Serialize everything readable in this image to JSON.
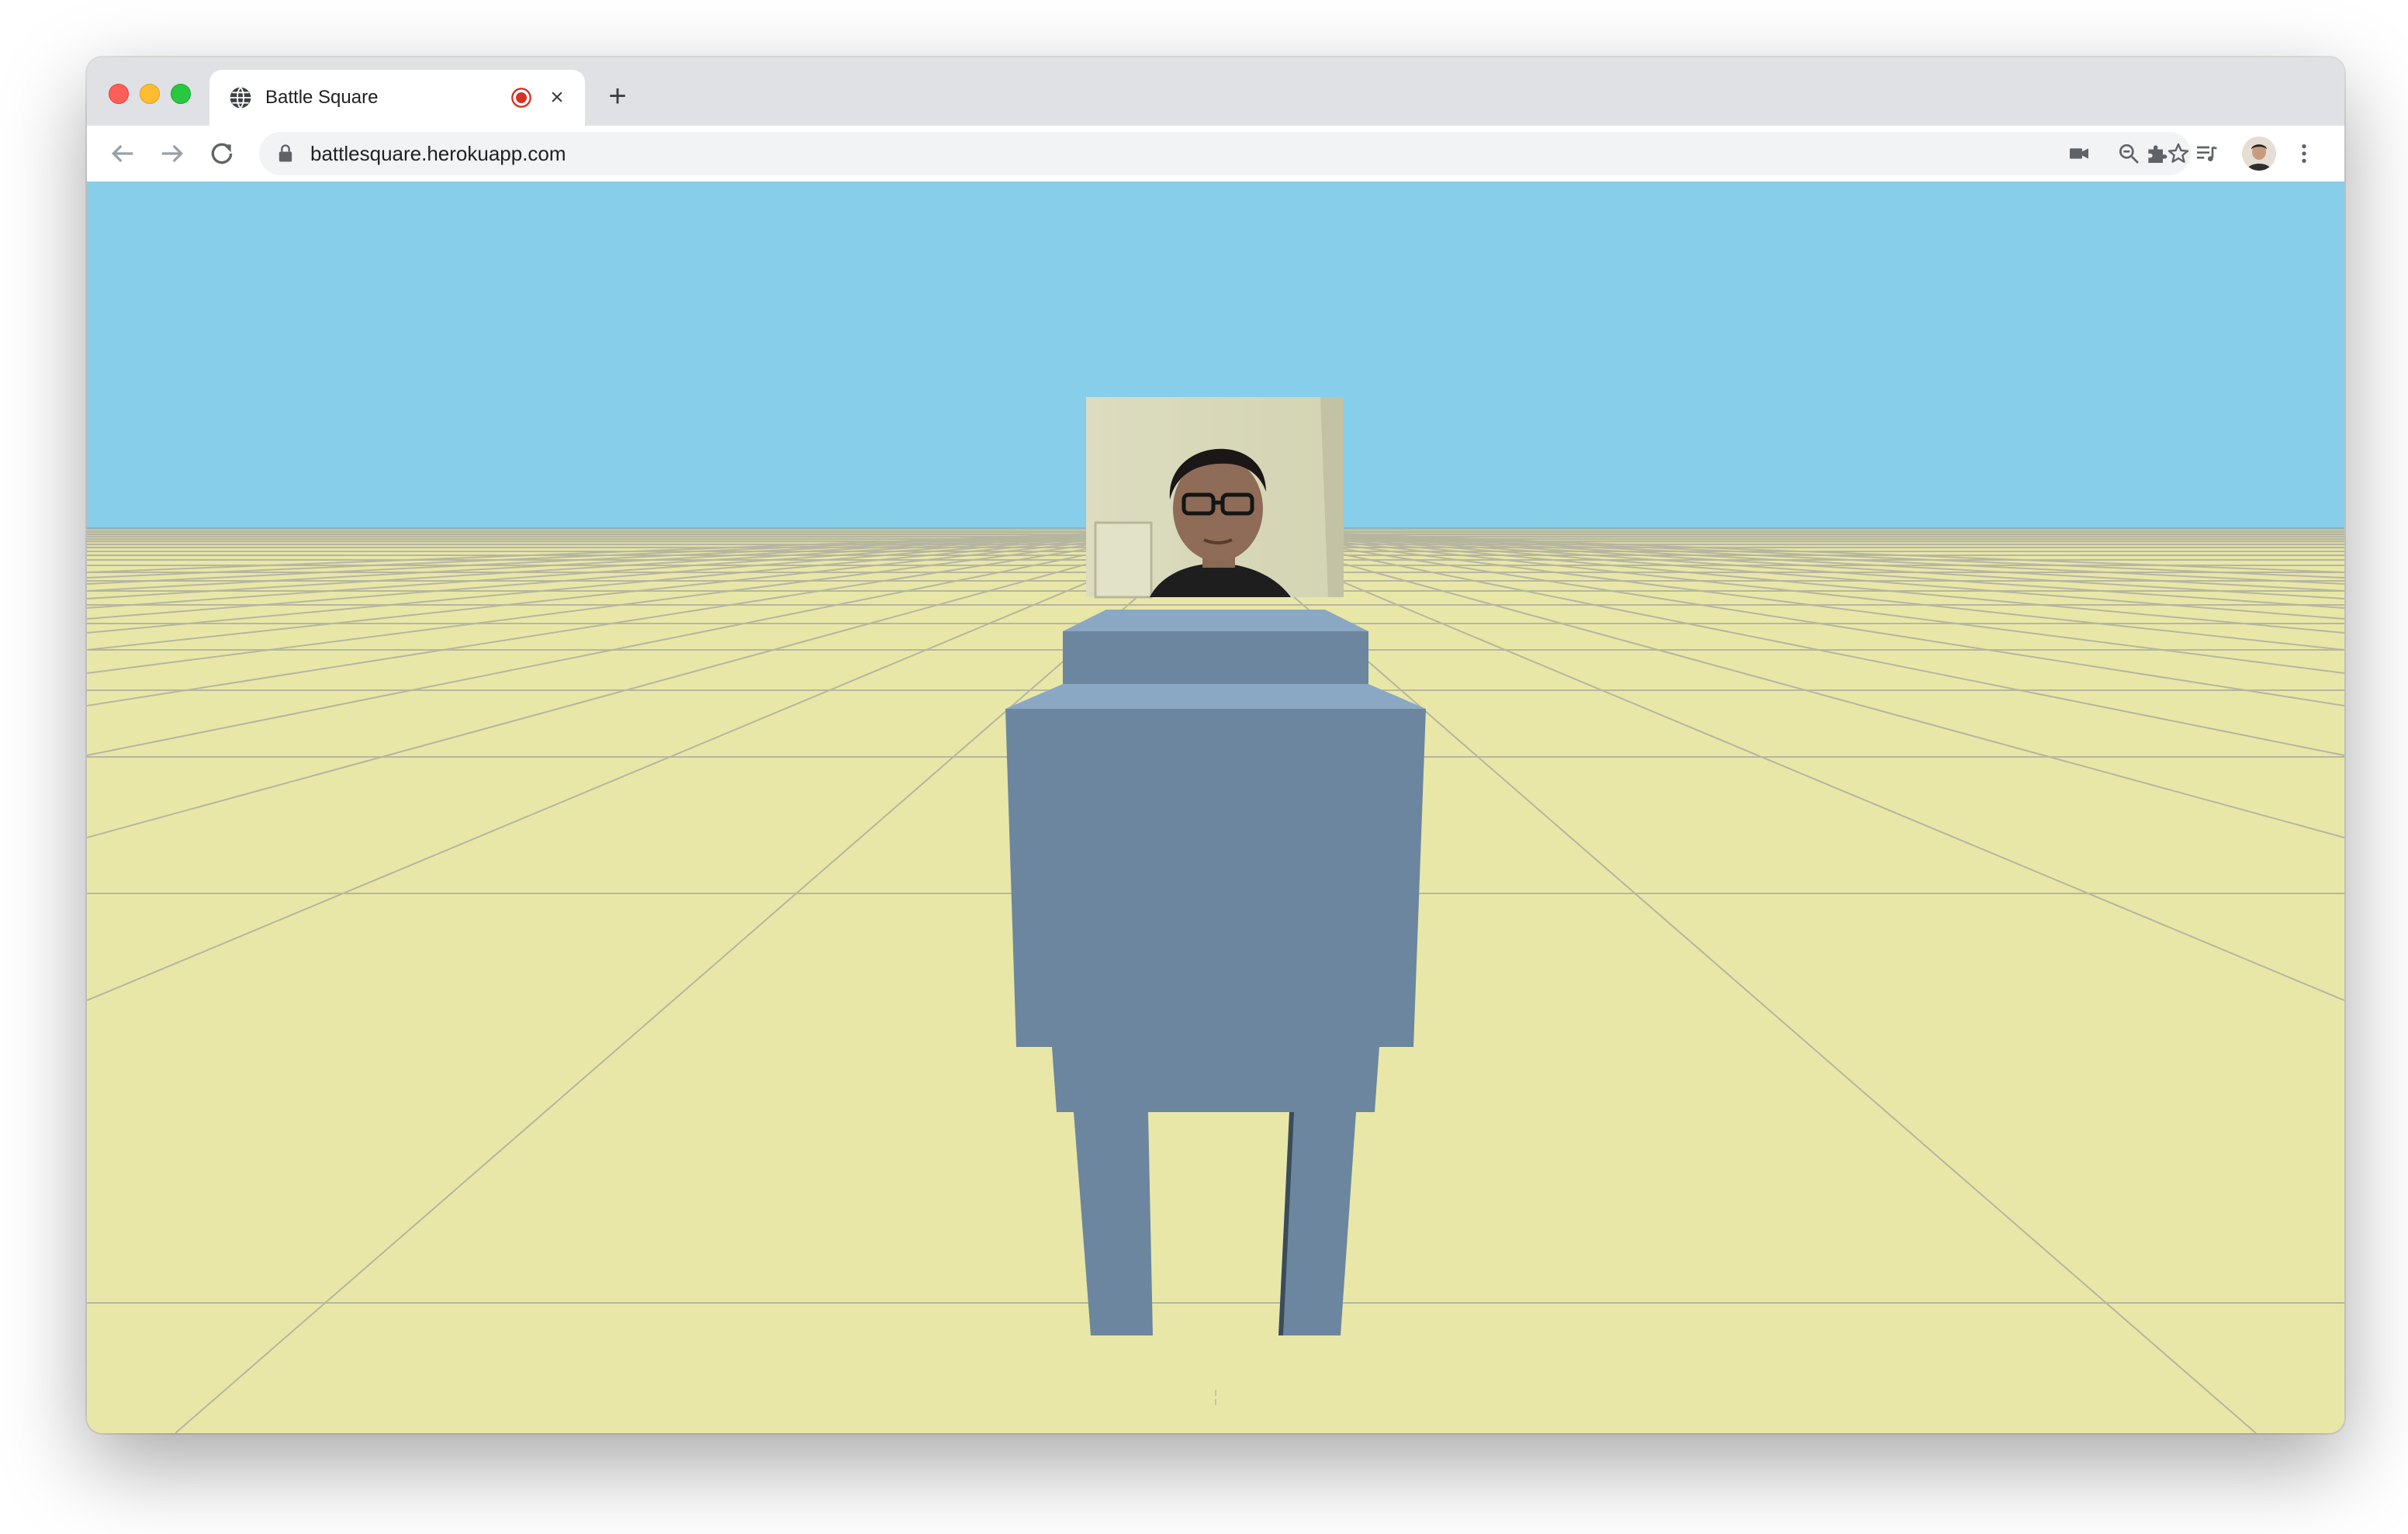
{
  "browser": {
    "tab": {
      "title": "Battle Square",
      "favicon": "globe-icon",
      "recording_indicator": "record-icon",
      "close": "×"
    },
    "new_tab": "+",
    "toolbar": {
      "back": "arrow-left-icon",
      "forward": "arrow-right-icon",
      "reload": "reload-icon",
      "url": "battlesquare.herokuapp.com",
      "secure_icon": "lock-icon",
      "camera_icon": "video-camera-icon",
      "zoom_icon": "zoom-out-icon",
      "bookmark_icon": "star-icon",
      "extensions_icon": "puzzle-icon",
      "media_icon": "media-queue-icon",
      "profile_icon": "avatar",
      "menu_icon": "kebab-menu-icon"
    }
  },
  "scene": {
    "sky_color": "#87ceea",
    "ground_color": "#e8e7a8",
    "grid_color": "#b7b7a4",
    "avatar_body_color": "#6b869e",
    "avatar_top_color": "#8aa8c4",
    "face_screen": "webcam-video-icon"
  }
}
